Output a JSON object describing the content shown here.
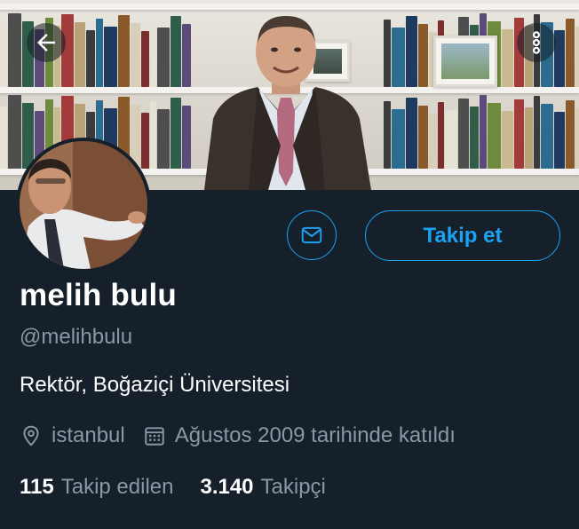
{
  "header": {
    "back_icon": "arrow-left-icon",
    "more_icon": "more-vertical-icon"
  },
  "profile": {
    "name": "melih bulu",
    "handle": "@melihbulu",
    "bio": "Rektör, Boğaziçi Üniversitesi",
    "location": "istanbul",
    "joined": "Ağustos 2009 tarihinde katıldı",
    "location_icon": "location-pin-icon",
    "joined_icon": "calendar-icon"
  },
  "actions": {
    "follow_label": "Takip et",
    "message_icon": "envelope-icon"
  },
  "stats": {
    "following_count": "115",
    "following_label": "Takip edilen",
    "followers_count": "3.140",
    "followers_label": "Takipçi"
  },
  "colors": {
    "background": "#15202b",
    "accent": "#1da1f2",
    "secondary_text": "#8899a6",
    "primary_text": "#ffffff"
  }
}
